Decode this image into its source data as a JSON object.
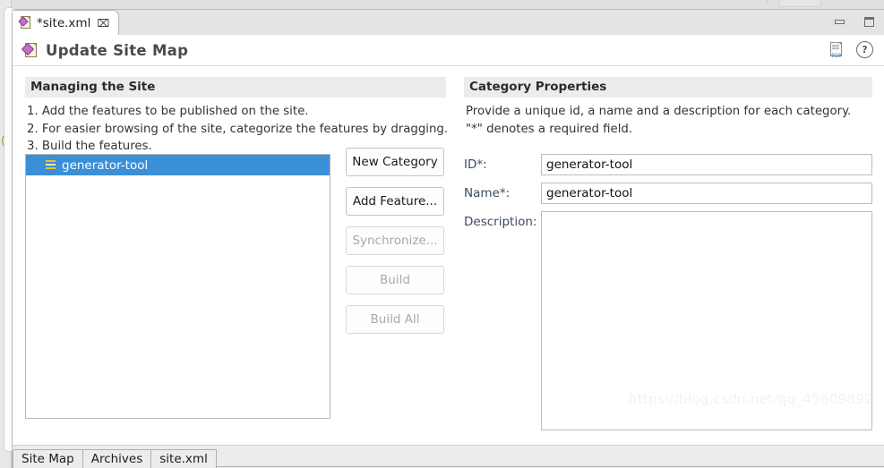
{
  "window": {
    "tab": {
      "label": "*site.xml",
      "close_glyph": "⌧",
      "icon": "xml-document-icon"
    },
    "controls": {
      "minimize": "Minimize",
      "maximize": "Maximize"
    },
    "top_partial_button": ""
  },
  "form_header": {
    "title": "Update Site Map",
    "icon": "update-site-document-icon",
    "actions": [
      {
        "name": "binary-source-icon",
        "label": "010"
      },
      {
        "name": "help-icon",
        "label": "?"
      }
    ]
  },
  "managing_section": {
    "title": "Managing the Site",
    "steps": [
      "1. Add the features to be published on the site.",
      "2. For easier browsing of the site, categorize the features by dragging.",
      "3. Build the features."
    ],
    "list": [
      {
        "label": "generator-tool",
        "icon": "category-icon",
        "selected": true
      }
    ],
    "buttons": [
      {
        "label": "New Category",
        "enabled": true
      },
      {
        "label": "Add Feature...",
        "enabled": true
      },
      {
        "label": "Synchronize...",
        "enabled": false
      },
      {
        "label": "Build",
        "enabled": false
      },
      {
        "label": "Build All",
        "enabled": false
      }
    ]
  },
  "category_section": {
    "title": "Category Properties",
    "description_lines": [
      "Provide a unique id, a name and a description for each category.",
      "\"*\" denotes a required field."
    ],
    "fields": [
      {
        "label": "ID*:",
        "value": "generator-tool",
        "placeholder": "",
        "type": "text"
      },
      {
        "label": "Name*:",
        "value": "generator-tool",
        "placeholder": "",
        "type": "text"
      },
      {
        "label": "Description:",
        "value": "",
        "placeholder": "",
        "type": "textarea"
      }
    ]
  },
  "bottom_tabs": [
    {
      "label": "Site Map",
      "active": true
    },
    {
      "label": "Archives",
      "active": false
    },
    {
      "label": "site.xml",
      "active": false
    }
  ],
  "watermark": "https://blog.csdn.net/qq_45609892",
  "colors": {
    "selection_blue": "#3b8fd7",
    "section_header_bg": "#ececec",
    "label_blue": "#3b4a5c",
    "category_icon_yellow": "#f0c020"
  }
}
